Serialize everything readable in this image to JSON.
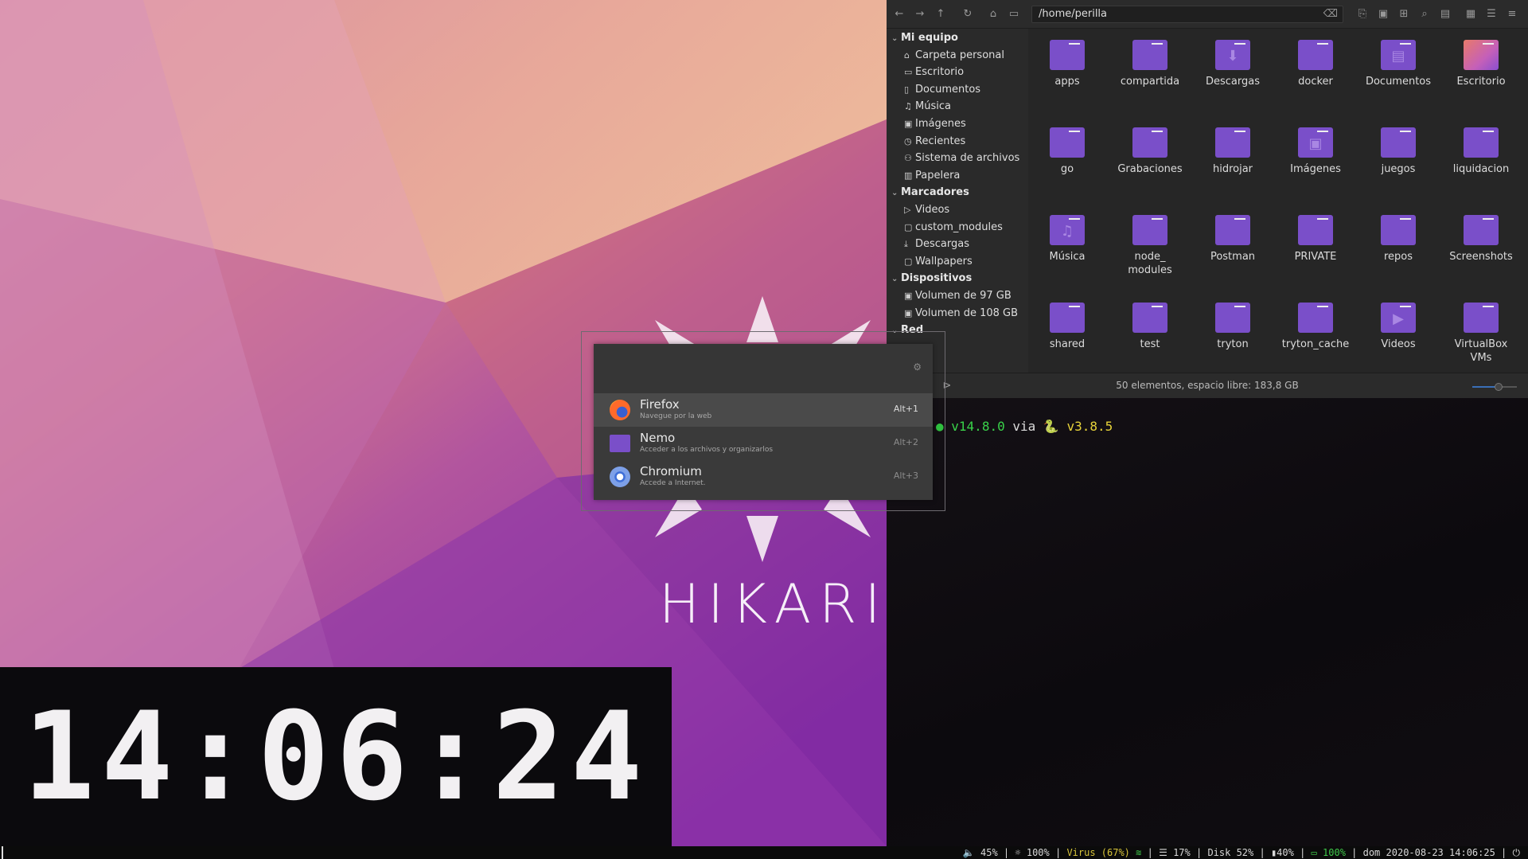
{
  "wallpaper": {
    "brand": "HIKARI"
  },
  "clock": {
    "time": "14:06:24"
  },
  "file_manager": {
    "path": "/home/perilla",
    "sidebar": {
      "sections": [
        {
          "label": "Mi equipo",
          "items": [
            {
              "label": "Carpeta personal",
              "icon": "home-icon"
            },
            {
              "label": "Escritorio",
              "icon": "desktop-icon"
            },
            {
              "label": "Documentos",
              "icon": "document-icon"
            },
            {
              "label": "Música",
              "icon": "music-icon"
            },
            {
              "label": "Imágenes",
              "icon": "image-icon"
            },
            {
              "label": "Recientes",
              "icon": "clock-icon"
            },
            {
              "label": "Sistema de archivos",
              "icon": "filesystem-icon"
            },
            {
              "label": "Papelera",
              "icon": "trash-icon"
            }
          ]
        },
        {
          "label": "Marcadores",
          "items": [
            {
              "label": "Videos",
              "icon": "video-icon"
            },
            {
              "label": "custom_modules",
              "icon": "folder-icon"
            },
            {
              "label": "Descargas",
              "icon": "download-icon"
            },
            {
              "label": "Wallpapers",
              "icon": "folder-icon"
            }
          ]
        },
        {
          "label": "Dispositivos",
          "items": [
            {
              "label": "Volumen de 97 GB",
              "icon": "drive-icon"
            },
            {
              "label": "Volumen de 108 GB",
              "icon": "drive-icon"
            }
          ]
        },
        {
          "label": "Red",
          "items": []
        }
      ]
    },
    "folders": [
      {
        "name": "apps",
        "glyph": ""
      },
      {
        "name": "compartida",
        "glyph": ""
      },
      {
        "name": "Descargas",
        "glyph": "⬇"
      },
      {
        "name": "docker",
        "glyph": ""
      },
      {
        "name": "Documentos",
        "glyph": "▤"
      },
      {
        "name": "Escritorio",
        "glyph": ""
      },
      {
        "name": "go",
        "glyph": ""
      },
      {
        "name": "Grabaciones",
        "glyph": ""
      },
      {
        "name": "hidrojar",
        "glyph": ""
      },
      {
        "name": "Imágenes",
        "glyph": "▣"
      },
      {
        "name": "juegos",
        "glyph": ""
      },
      {
        "name": "liquidacion",
        "glyph": ""
      },
      {
        "name": "Música",
        "glyph": "♫"
      },
      {
        "name": "node_\nmodules",
        "glyph": ""
      },
      {
        "name": "Postman",
        "glyph": ""
      },
      {
        "name": "PRIVATE",
        "glyph": ""
      },
      {
        "name": "repos",
        "glyph": ""
      },
      {
        "name": "Screenshots",
        "glyph": ""
      },
      {
        "name": "shared",
        "glyph": ""
      },
      {
        "name": "test",
        "glyph": ""
      },
      {
        "name": "tryton",
        "glyph": ""
      },
      {
        "name": "tryton_cache",
        "glyph": ""
      },
      {
        "name": "Videos",
        "glyph": "▶"
      },
      {
        "name": "VirtualBox\nVMs",
        "glyph": ""
      }
    ],
    "status": "50 elementos, espacio libre: 183,8 GB",
    "accent": "#7a4fc9"
  },
  "terminal": {
    "node_version": "v14.8.0",
    "via": "via",
    "python_icon": "🐍",
    "python_version": "v3.8.5"
  },
  "launcher": {
    "apps": [
      {
        "name": "Firefox",
        "desc": "Navegue por la web",
        "shortcut": "Alt+1",
        "icon": "firefox-icon"
      },
      {
        "name": "Nemo",
        "desc": "Acceder a los archivos y organizarlos",
        "shortcut": "Alt+2",
        "icon": "nemo-folder-icon"
      },
      {
        "name": "Chromium",
        "desc": "Accede a Internet.",
        "shortcut": "Alt+3",
        "icon": "chromium-icon"
      }
    ]
  },
  "statusbar": {
    "volume": "45%",
    "brightness": "100%",
    "wifi": "Virus (67%)",
    "memory": "17%",
    "disk": "Disk 52%",
    "cpu_icon": "40%",
    "battery": "100%",
    "day": "dom",
    "date": "2020-08-23",
    "time": "14:06:25"
  }
}
